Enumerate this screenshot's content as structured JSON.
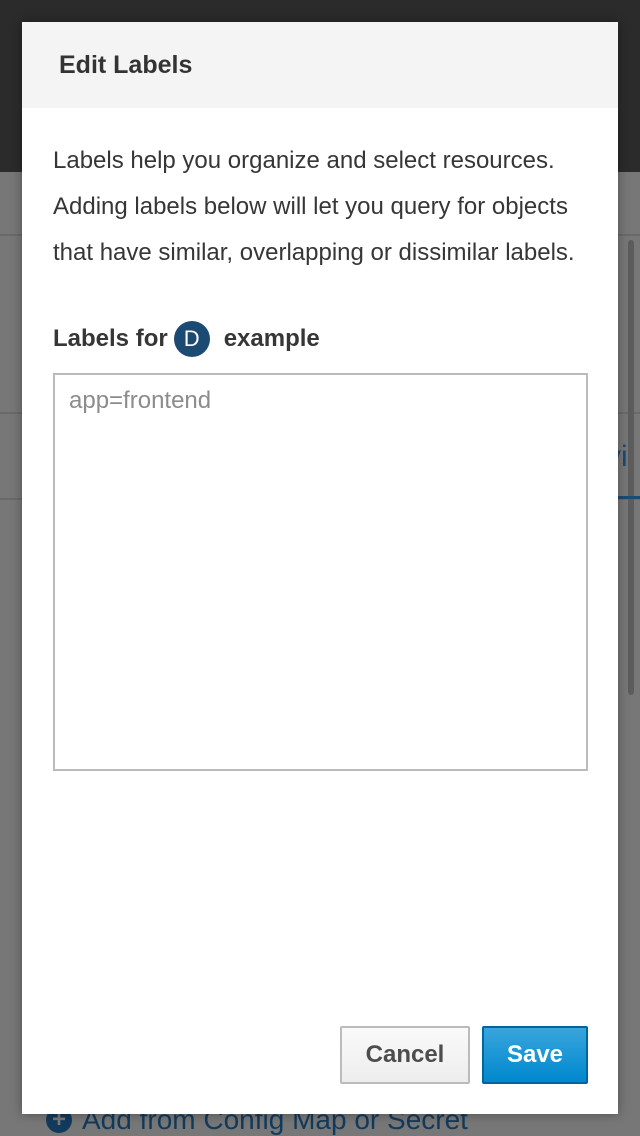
{
  "modal": {
    "title": "Edit Labels",
    "description": "Labels help you organize and select resources. Adding labels below will let you query for objects that have similar, overlapping or dissimilar labels.",
    "labels_for_prefix": "Labels for",
    "resource_badge_letter": "D",
    "resource_name": "example",
    "labels_textarea": {
      "value": "",
      "placeholder": "app=frontend"
    },
    "buttons": {
      "cancel_label": "Cancel",
      "save_label": "Save"
    }
  },
  "background": {
    "tab_fragment": "vi",
    "add_link_label": "Add from Config Map or Secret"
  },
  "colors": {
    "badge_bg": "#1b4b73",
    "primary_button": "#0088ce",
    "header_bg": "#f4f4f4"
  }
}
